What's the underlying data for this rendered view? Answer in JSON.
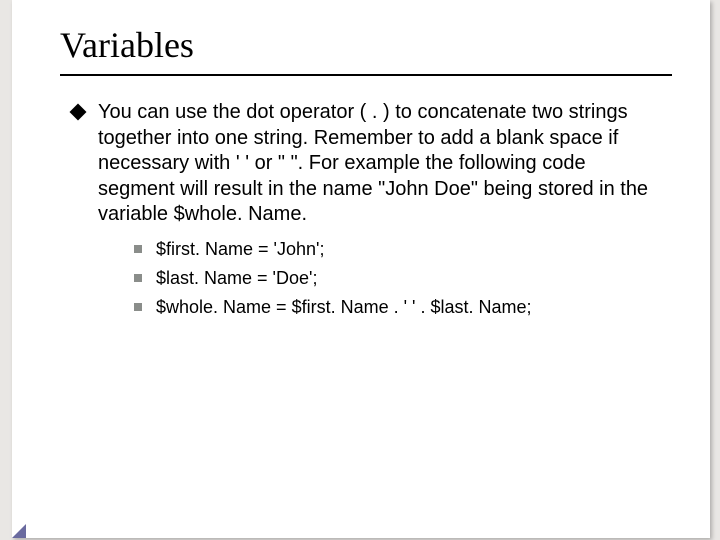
{
  "title": "Variables",
  "bullet": {
    "text": "You can use the dot operator ( . ) to concatenate two strings together into one string. Remember to add a blank space if necessary with ' ' or \" \". For example the following code segment will result in the name \"John Doe\" being stored in the variable $whole. Name."
  },
  "code": {
    "line1": "$first. Name = 'John';",
    "line2": "$last. Name = 'Doe';",
    "line3": "$whole. Name = $first. Name . ' ' . $last. Name;"
  }
}
